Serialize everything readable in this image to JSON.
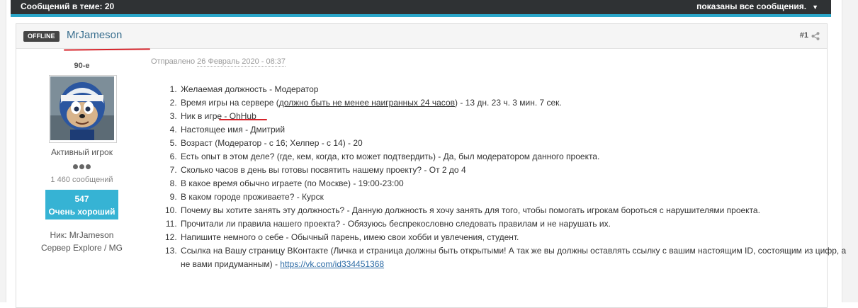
{
  "topbar": {
    "messages_count": "Сообщений в теме: 20",
    "shown_all": "показаны все сообщения."
  },
  "post": {
    "status_badge": "OFFLINE",
    "author": "MrJameson",
    "number": "#1",
    "posted_prefix": "Отправлено",
    "posted_date": "26 Февраль 2020 - 08:37"
  },
  "user": {
    "group": "90-е",
    "rank": "Активный игрок",
    "posts": "1 460 сообщений",
    "reputation_value": "547",
    "reputation_label": "Очень хороший",
    "nick": "Ник: MrJameson",
    "server": "Сервер Explore / MG"
  },
  "answers": {
    "q1": "Желаемая должность - Модератор",
    "q2_a": "Время игры на сервере (",
    "q2_u": "должно быть не менее наигранных 24 часов",
    "q2_b": ") - 13 дн. 23 ч. 3 мин. 7 сек.",
    "q3": "Ник в игре - OhHub",
    "q4": "Настоящее имя - Дмитрий",
    "q5": "Возраст  (Модератор - с 16; Хелпер - с 14) - 20",
    "q6": "Есть опыт в этом деле? (где, кем, когда, кто может подтвердить) - Да, был модератором данного проекта.",
    "q7": "Сколько часов в день вы готовы посвятить нашему проекту? - От 2 до 4",
    "q8": "В какое время обычно играете (по Москве) - 19:00-23:00",
    "q9": "В каком городе проживаете? - Курск",
    "q10": "Почему вы хотите занять эту должность? - Данную должность я хочу занять для того, чтобы помогать игрокам бороться с нарушителями проекта.",
    "q11": "Прочитали ли правила нашего проекта? - Обязуюсь беспрекословно следовать правилам и не нарушать их.",
    "q12": "Напишите немного о себе - Обычный парень, имею свои хобби и увлечения, студент.",
    "q13": "Ссылка на Вашу страницу ВКонтакте (Личка и страница должны быть открытыми! А так же вы должны оставлять ссылку с вашим настоящим ID, состоящим из цифр, а не вами придуманным) - ",
    "q13_link": "https://vk.com/id334451368"
  },
  "colors": {
    "topbar": "#2f3234",
    "accent": "#2aa6c9",
    "reputation_bg": "#36b3d4",
    "annotation_red": "#d6232a",
    "author_link": "#3a6f8f"
  }
}
